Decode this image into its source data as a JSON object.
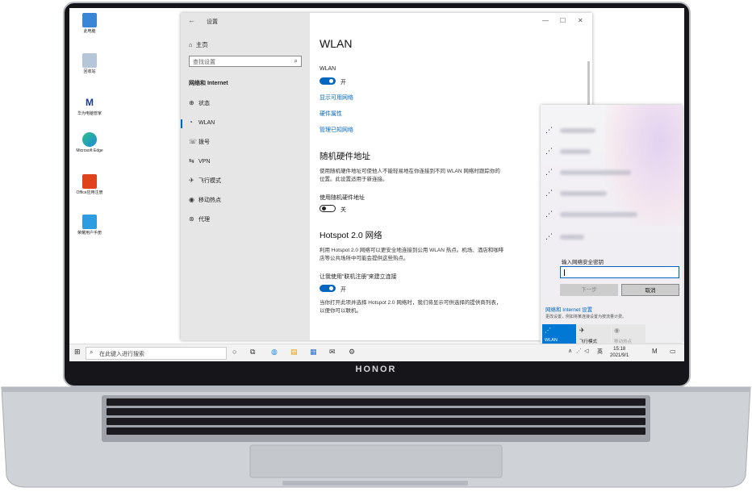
{
  "brand": {
    "chin_logo": "HONOR"
  },
  "desktop_icons": [
    {
      "label": "此电脑",
      "color": "#3a86d6"
    },
    {
      "label": "回收站",
      "color": "#7aa0c8"
    },
    {
      "label": "华为电脑管家",
      "color": "#1e3c8c"
    },
    {
      "label": "Microsoft Edge",
      "color": "#1f8ad6"
    },
    {
      "label": "Office应用注册",
      "color": "#e0431b"
    },
    {
      "label": "荣耀用户手册",
      "color": "#2f9be0"
    }
  ],
  "settings": {
    "window_title": "设置",
    "home": "主页",
    "search_placeholder": "查找设置",
    "section": "网络和 Internet",
    "nav": [
      {
        "label": "状态",
        "icon": "status-icon"
      },
      {
        "label": "WLAN",
        "icon": "wifi-icon",
        "selected": true
      },
      {
        "label": "拨号",
        "icon": "dialup-icon"
      },
      {
        "label": "VPN",
        "icon": "vpn-icon"
      },
      {
        "label": "飞行模式",
        "icon": "airplane-icon"
      },
      {
        "label": "移动热点",
        "icon": "hotspot-icon"
      },
      {
        "label": "代理",
        "icon": "globe-icon"
      }
    ],
    "page_title": "WLAN",
    "wlan_label": "WLAN",
    "wlan_state": "开",
    "links": [
      "显示可用网络",
      "硬件属性",
      "管理已知网络"
    ],
    "random_title": "随机硬件地址",
    "random_desc": "使用随机硬件地址可使他人不能轻易地在你连接到不同 WLAN 网络时跟踪你的位置。此设置适用于新连接。",
    "random_label": "使用随机硬件地址",
    "random_state": "关",
    "hotspot_title": "Hotspot 2.0 网络",
    "hotspot_desc": "利用 Hotspot 2.0 网络可以更安全地连接到公用 WLAN 热点。机场、酒店和咖啡店等公共场所中可能会提供这些热点。",
    "hotspot_label": "让我使用“联机注册”来建立连接",
    "hotspot_state": "开",
    "hotspot_note": "当你打开此项并选择 Hotspot 2.0 网络时，我们将显示可供选择的提供商列表，以便你可以联机。"
  },
  "flyout": {
    "key_label": "输入网络安全密钥",
    "next": "下一步",
    "cancel": "取消",
    "net_settings": "网络和 Internet 设置",
    "net_settings_sub": "更改设置，例如将某连接设置为按流量计费。",
    "quick": [
      {
        "label": "WLAN",
        "active": true
      },
      {
        "label": "飞行模式",
        "active": false
      },
      {
        "label": "移动热点",
        "active": false
      }
    ]
  },
  "taskbar": {
    "search_placeholder": "在此键入进行搜索",
    "ime": "英",
    "time": "15:18",
    "date": "2021/9/1"
  }
}
